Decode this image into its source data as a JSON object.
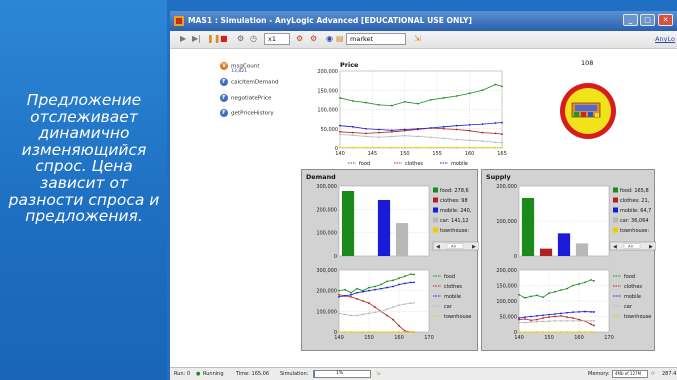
{
  "slide_text": "Предложение отслеживает динамично изменяющийся спрос. Цена зависит от разности спроса и предложения.",
  "window": {
    "title": "MAS1 : Simulation - AnyLogic Advanced [EDUCATIONAL USE ONLY]",
    "controls": [
      "minimize",
      "maximize",
      "close"
    ]
  },
  "toolbar": {
    "speed_label": "x1",
    "search_value": "market",
    "link_label": "AnyLo"
  },
  "agent_items": [
    {
      "icon": "variable-icon",
      "label": "msgCount",
      "sub": "13,821"
    },
    {
      "icon": "function-icon",
      "label": "calcItemDemand"
    },
    {
      "icon": "function-icon",
      "label": "negotiatePrice"
    },
    {
      "icon": "function-icon",
      "label": "getPriceHistory"
    }
  ],
  "count_value": "108",
  "colors": {
    "food": "#1a8a1a",
    "clothes": "#b02020",
    "mobile": "#1a1ad8",
    "car": "#b8b8b8",
    "townhouse": "#e8d000"
  },
  "price_chart": {
    "title": "Price",
    "yticks": [
      "200,000",
      "150,000",
      "100,000",
      "50,000",
      "0"
    ],
    "xticks": [
      "140",
      "145",
      "150",
      "155",
      "160",
      "165"
    ],
    "legend": [
      "food",
      "clothes",
      "mobile",
      "car",
      "townhouse"
    ]
  },
  "demand_panel": {
    "title": "Demand",
    "bar_yticks": [
      "300,000",
      "200,000",
      "100,000",
      "0"
    ],
    "bar_legend": [
      "food: 278,6",
      "clothes: 98",
      "mobile: 240,",
      "car: 141,12",
      "townhouse:"
    ],
    "line_yticks": [
      "300,000",
      "200,000",
      "100,000",
      "0"
    ],
    "line_xticks": [
      "140",
      "150",
      "160",
      "170"
    ],
    "line_legend": [
      "food",
      "clothes",
      "mobile",
      "car",
      "townhouse"
    ],
    "scroll_label": "All"
  },
  "supply_panel": {
    "title": "Supply",
    "bar_yticks": [
      "200,000",
      "100,000",
      "0"
    ],
    "bar_legend": [
      "food: 165,8",
      "clothes: 21,",
      "mobile: 64,7",
      "car: 36,064",
      "townhouse:"
    ],
    "line_yticks": [
      "200,000",
      "150,000",
      "100,000",
      "50,000",
      "0"
    ],
    "line_xticks": [
      "140",
      "150",
      "160",
      "170"
    ],
    "line_legend": [
      "food",
      "clothes",
      "mobile",
      "car",
      "townhouse"
    ],
    "scroll_label": "All"
  },
  "chart_data": [
    {
      "type": "line",
      "title": "Price",
      "xlim": [
        140,
        165
      ],
      "ylim": [
        0,
        200000
      ],
      "x": [
        140,
        142,
        144,
        146,
        148,
        150,
        152,
        154,
        156,
        158,
        160,
        162,
        164,
        165
      ],
      "series": [
        {
          "name": "food",
          "values": [
            130000,
            122000,
            118000,
            112000,
            110000,
            120000,
            115000,
            125000,
            130000,
            135000,
            142000,
            150000,
            165000,
            160000
          ]
        },
        {
          "name": "clothes",
          "values": [
            42000,
            40000,
            38000,
            40000,
            42000,
            45000,
            48000,
            52000,
            50000,
            48000,
            45000,
            40000,
            38000,
            36000
          ]
        },
        {
          "name": "mobile",
          "values": [
            58000,
            55000,
            50000,
            48000,
            46000,
            48000,
            50000,
            52000,
            55000,
            58000,
            60000,
            62000,
            65000,
            66000
          ]
        },
        {
          "name": "car",
          "values": [
            35000,
            33000,
            30000,
            28000,
            30000,
            32000,
            30000,
            28000,
            25000,
            22000,
            20000,
            18000,
            15000,
            14000
          ]
        },
        {
          "name": "townhouse",
          "values": [
            1000,
            1000,
            1000,
            1000,
            1000,
            1000,
            1000,
            1000,
            1000,
            1000,
            1000,
            1000,
            1000,
            1000
          ]
        }
      ]
    },
    {
      "type": "bar",
      "categories": [
        "food",
        "clothes",
        "mobile",
        "car",
        "townhouse"
      ],
      "values": [
        278600,
        98,
        240000,
        141120,
        0
      ],
      "ylim": [
        0,
        300000
      ]
    },
    {
      "type": "line",
      "xlim": [
        140,
        170
      ],
      "ylim": [
        0,
        300000
      ],
      "x": [
        140,
        142,
        144,
        146,
        148,
        150,
        152,
        154,
        156,
        158,
        160,
        162,
        164,
        165
      ],
      "series": [
        {
          "name": "food",
          "values": [
            200000,
            205000,
            190000,
            210000,
            200000,
            215000,
            220000,
            230000,
            245000,
            250000,
            260000,
            270000,
            280000,
            278000
          ]
        },
        {
          "name": "clothes",
          "values": [
            180000,
            175000,
            170000,
            160000,
            150000,
            140000,
            120000,
            100000,
            80000,
            60000,
            30000,
            5000,
            100,
            98
          ]
        },
        {
          "name": "mobile",
          "values": [
            170000,
            175000,
            180000,
            190000,
            195000,
            200000,
            205000,
            210000,
            215000,
            220000,
            230000,
            235000,
            240000,
            240000
          ]
        },
        {
          "name": "car",
          "values": [
            90000,
            85000,
            80000,
            80000,
            85000,
            90000,
            95000,
            100000,
            110000,
            120000,
            130000,
            135000,
            140000,
            141000
          ]
        },
        {
          "name": "townhouse",
          "values": [
            0,
            0,
            0,
            0,
            0,
            0,
            0,
            0,
            0,
            0,
            0,
            0,
            0,
            0
          ]
        }
      ]
    },
    {
      "type": "bar",
      "categories": [
        "food",
        "clothes",
        "mobile",
        "car",
        "townhouse"
      ],
      "values": [
        165800,
        21000,
        64700,
        36064,
        0
      ],
      "ylim": [
        0,
        200000
      ]
    },
    {
      "type": "line",
      "xlim": [
        140,
        170
      ],
      "ylim": [
        0,
        200000
      ],
      "x": [
        140,
        142,
        144,
        146,
        148,
        150,
        152,
        154,
        156,
        158,
        160,
        162,
        164,
        165
      ],
      "series": [
        {
          "name": "food",
          "values": [
            120000,
            110000,
            115000,
            118000,
            112000,
            125000,
            130000,
            135000,
            140000,
            150000,
            155000,
            160000,
            168000,
            165000
          ]
        },
        {
          "name": "clothes",
          "values": [
            40000,
            42000,
            38000,
            40000,
            45000,
            48000,
            50000,
            52000,
            48000,
            45000,
            40000,
            35000,
            25000,
            21000
          ]
        },
        {
          "name": "mobile",
          "values": [
            45000,
            48000,
            50000,
            52000,
            54000,
            56000,
            58000,
            60000,
            62000,
            64000,
            65000,
            66000,
            65000,
            64700
          ]
        },
        {
          "name": "car",
          "values": [
            30000,
            30000,
            32000,
            33000,
            34000,
            35000,
            36000,
            36000,
            36000,
            36000,
            36000,
            36000,
            36000,
            36064
          ]
        },
        {
          "name": "townhouse",
          "values": [
            0,
            0,
            0,
            0,
            0,
            0,
            0,
            0,
            0,
            0,
            0,
            0,
            0,
            0
          ]
        }
      ]
    }
  ],
  "status": {
    "run_label": "Run: 0",
    "state": "Running",
    "time_label": "Time: 165.06",
    "sim_label": "Simulation:",
    "progress_label": "1%",
    "progress_fraction": 0.02,
    "memory_label": "Memory:",
    "memory_value": "4Mb of 127M",
    "extra": "287.4"
  }
}
